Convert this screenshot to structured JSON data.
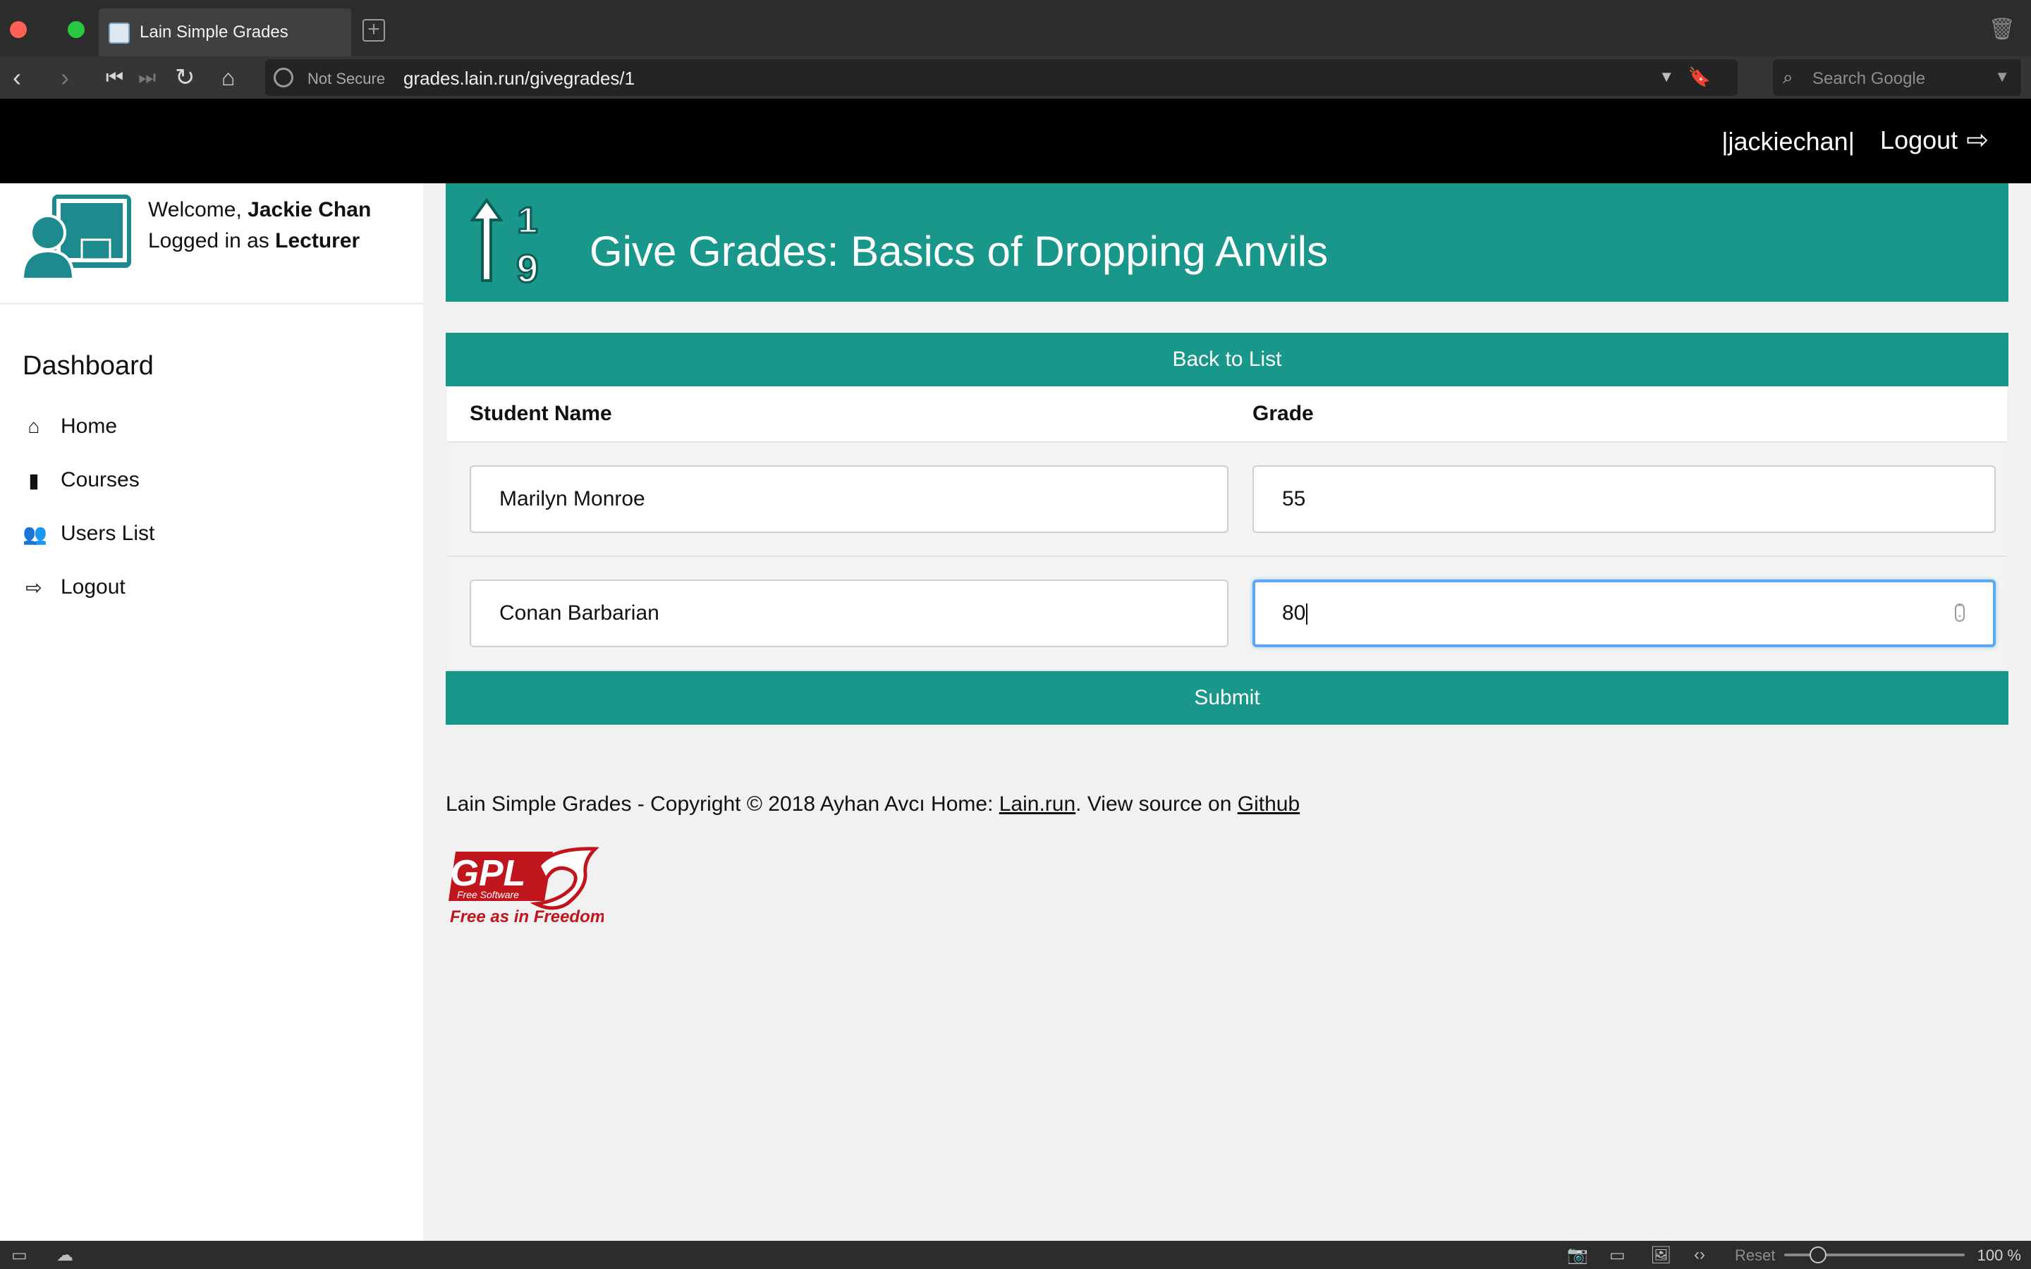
{
  "browser": {
    "tab_title": "Lain Simple Grades",
    "security_label": "Not Secure",
    "url": "grades.lain.run/givegrades/1",
    "search_placeholder": "Search Google",
    "zoom_reset_label": "Reset",
    "zoom_level": "100 %"
  },
  "header": {
    "username": "|jackiechan|",
    "logout_label": "Logout"
  },
  "sidebar": {
    "welcome_prefix": "Welcome,",
    "welcome_name": "Jackie Chan",
    "role_prefix": "Logged in as",
    "role": "Lecturer",
    "section_title": "Dashboard",
    "items": [
      {
        "label": "Home",
        "icon": "home-icon"
      },
      {
        "label": "Courses",
        "icon": "book-icon"
      },
      {
        "label": "Users List",
        "icon": "users-icon"
      },
      {
        "label": "Logout",
        "icon": "sign-out-icon"
      }
    ]
  },
  "main": {
    "page_title": "Give Grades: Basics of Dropping Anvils",
    "banner_icon": "sort-numeric-icon",
    "back_label": "Back to List",
    "submit_label": "Submit",
    "columns": {
      "student": "Student Name",
      "grade": "Grade"
    },
    "rows": [
      {
        "student": "Marilyn Monroe",
        "grade": "55"
      },
      {
        "student": "Conan Barbarian",
        "grade": "80"
      }
    ]
  },
  "footer": {
    "text_before": "Lain Simple Grades - Copyright © 2018 Ayhan Avcı Home: ",
    "home_link": "Lain.run",
    "text_middle": ". View source on ",
    "source_link": "Github",
    "badge_top": "GPL",
    "badge_small": "Free Software",
    "badge_bottom": "Free as in Freedom"
  },
  "colors": {
    "accent": "#18978a",
    "header_bg": "#000000",
    "badge_red": "#c0151d"
  }
}
